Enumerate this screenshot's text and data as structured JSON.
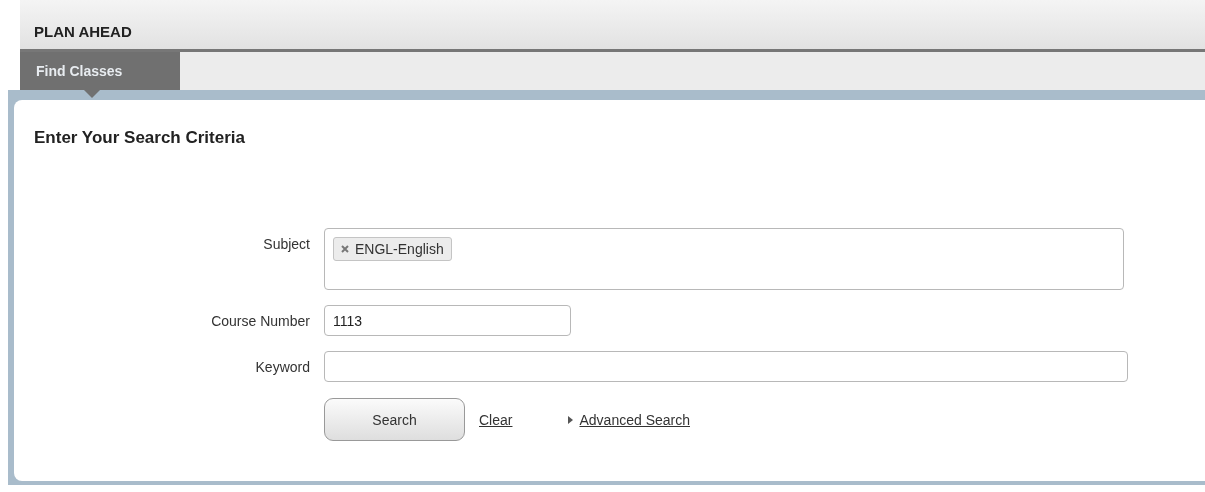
{
  "header": {
    "title": "PLAN AHEAD"
  },
  "tabs": [
    {
      "label": "Find Classes",
      "selected": true
    }
  ],
  "form": {
    "heading": "Enter Your Search Criteria",
    "fields": [
      {
        "kind": "tags",
        "label": "Subject",
        "tags": [
          "ENGL-English"
        ]
      },
      {
        "kind": "text",
        "label": "Course Number",
        "value": "1113"
      },
      {
        "kind": "wide",
        "label": "Keyword"
      }
    ],
    "actions": [
      {
        "kind": "button",
        "label": "Search"
      },
      {
        "kind": "link",
        "label": "Clear"
      },
      {
        "kind": "disclosure",
        "label": "Advanced Search",
        "expanded": false
      }
    ]
  }
}
